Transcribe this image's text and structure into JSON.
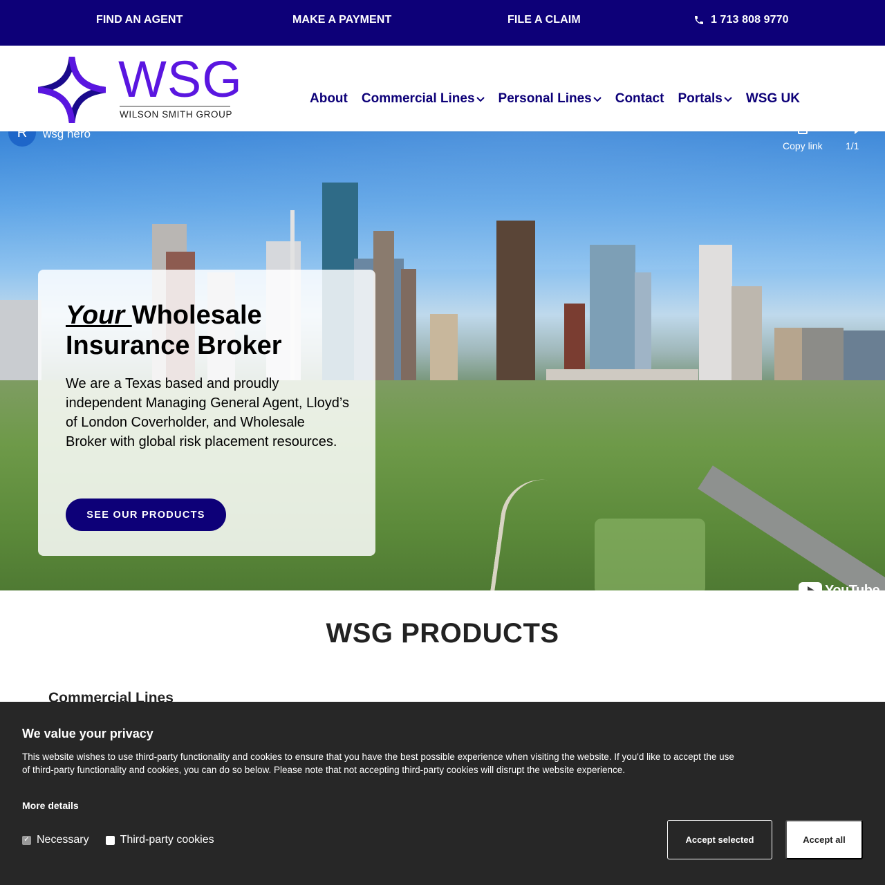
{
  "topbar": {
    "find_agent": "FIND AN AGENT",
    "make_payment": "MAKE A PAYMENT",
    "file_claim": "FILE A CLAIM",
    "phone": "1 713 808 9770",
    "phone_icon": "phone-icon"
  },
  "logo": {
    "wordmark": "WSG",
    "subtitle": "WILSON SMITH GROUP"
  },
  "nav": {
    "items": [
      {
        "label": "About",
        "dropdown": false
      },
      {
        "label": "Commercial Lines",
        "dropdown": true
      },
      {
        "label": "Personal Lines",
        "dropdown": true
      },
      {
        "label": "Contact",
        "dropdown": false
      },
      {
        "label": "Portals",
        "dropdown": true
      },
      {
        "label": "WSG UK",
        "dropdown": false
      }
    ]
  },
  "video": {
    "channel_initial": "R",
    "title": "wsg hero",
    "copy_link": "Copy link",
    "count": "1/1",
    "provider": "YouTube"
  },
  "hero": {
    "heading_em": "Your ",
    "heading_rest": "Wholesale Insurance Broker",
    "text": "We are a Texas based and proudly independent Managing General Agent, Lloyd’s of London Coverholder, and Wholesale Broker with global risk placement resources.",
    "cta": "SEE OUR PRODUCTS"
  },
  "products": {
    "title": "WSG PRODUCTS",
    "first_category": "Commercial Lines"
  },
  "cookie": {
    "title": "We value your privacy",
    "text": "This website wishes to use third-party functionality and cookies to ensure that you have the best possible experience when visiting the website. If you'd like to accept the use of third-party functionality and cookies, you can do so below. Please note that not accepting third-party cookies will disrupt the website experience.",
    "more": "More details",
    "options": [
      {
        "label": "Necessary",
        "checked": true
      },
      {
        "label": "Third-party cookies",
        "checked": false
      }
    ],
    "accept_selected": "Accept selected",
    "accept_all": "Accept all"
  },
  "colors": {
    "brand_navy": "#0d0078",
    "brand_purple": "#5a16e0",
    "cookie_bg": "#272727"
  }
}
